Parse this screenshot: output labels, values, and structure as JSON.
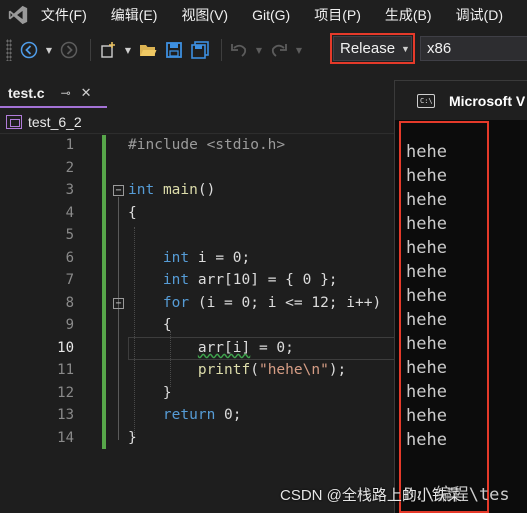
{
  "menu": {
    "items": [
      "文件(F)",
      "编辑(E)",
      "视图(V)",
      "Git(G)",
      "项目(P)",
      "生成(B)",
      "调试(D)"
    ]
  },
  "toolbar": {
    "configuration": "Release",
    "platform": "x86"
  },
  "tab": {
    "filename": "test.c",
    "pin_icon": "pin-icon",
    "close_icon": "close-icon"
  },
  "navbar": {
    "scope": "test_6_2"
  },
  "editor": {
    "line_numbers": [
      "1",
      "2",
      "3",
      "4",
      "5",
      "6",
      "7",
      "8",
      "9",
      "10",
      "11",
      "12",
      "13",
      "14"
    ],
    "current_line": "10",
    "lines": [
      "#include <stdio.h>",
      "",
      "int main()",
      "{",
      "",
      "    int i = 0;",
      "    int arr[10] = { 0 };",
      "    for (i = 0; i <= 12; i++)",
      "    {",
      "        arr[i] = 0;",
      "        printf(\"hehe\\n\");",
      "    }",
      "    return 0;",
      "}"
    ]
  },
  "console": {
    "title": "Microsoft V",
    "output": [
      "hehe",
      "hehe",
      "hehe",
      "hehe",
      "hehe",
      "hehe",
      "hehe",
      "hehe",
      "hehe",
      "hehe",
      "hehe",
      "hehe",
      "hehe"
    ],
    "prompt": "D:\\编程\\tes"
  },
  "watermark": "CSDN @全栈路上的小铁菜",
  "colors": {
    "highlight_box": "#e53a2a",
    "change_bar": "#57a64a",
    "keyword": "#569cd6",
    "string": "#d69d85",
    "tab_accent": "#a372d6"
  }
}
